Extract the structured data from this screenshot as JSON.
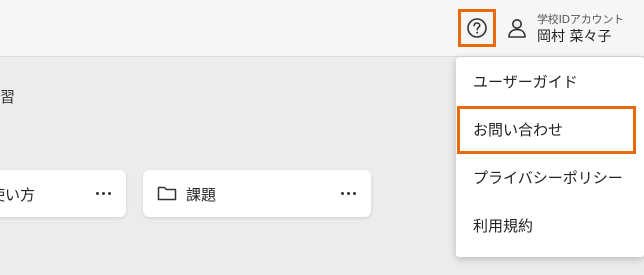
{
  "header": {
    "help_icon": "help-circle-icon",
    "user_icon": "person-icon",
    "account_type": "学校IDアカウント",
    "account_name": "岡村 菜々子"
  },
  "main": {
    "heading_fragment": "習",
    "cards": [
      {
        "label": "使い方",
        "menu_icon": "more-horizontal-icon"
      },
      {
        "label": "課題",
        "icon": "folder-icon",
        "menu_icon": "more-horizontal-icon"
      }
    ]
  },
  "help_menu": {
    "items": [
      {
        "label": "ユーザーガイド"
      },
      {
        "label": "お問い合わせ"
      },
      {
        "label": "プライバシーポリシー"
      },
      {
        "label": "利用規約"
      }
    ]
  },
  "colors": {
    "highlight": "#e96a0c",
    "background": "#ececec",
    "header": "#f6f6f6"
  }
}
